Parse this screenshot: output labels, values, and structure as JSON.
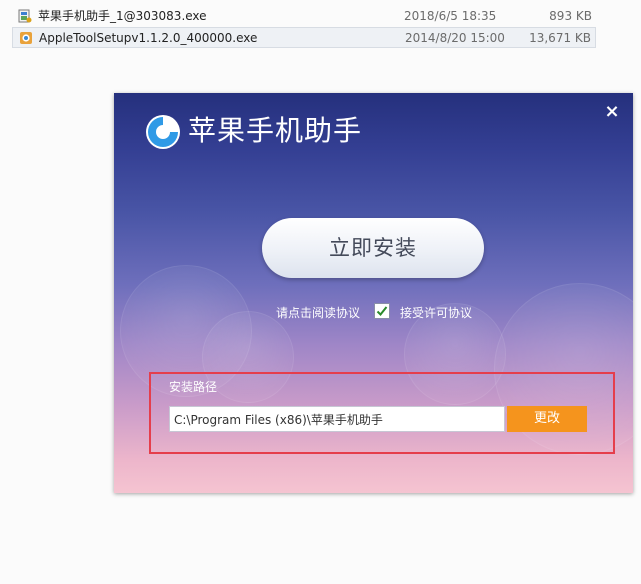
{
  "file_list": {
    "rows": [
      {
        "name": "苹果手机助手_1@303083.exe",
        "date": "2018/6/5 18:35",
        "size": "893 KB",
        "icon": "installer-app-icon"
      },
      {
        "name": "AppleToolSetupv1.1.2.0_400000.exe",
        "date": "2014/8/20 15:00",
        "size": "13,671 KB",
        "icon": "apple-tool-exe-icon"
      }
    ]
  },
  "installer": {
    "title": "苹果手机助手",
    "close_label": "×",
    "install_button": "立即安装",
    "read_agreement": "请点击阅读协议",
    "accept_checked": true,
    "accept_label": "接受许可协议",
    "path_label": "安装路径",
    "path_value": "C:\\Program Files (x86)\\苹果手机助手",
    "change_button": "更改",
    "colors": {
      "accent": "#f5941d",
      "highlight_frame": "#e53e4c",
      "logo_blue": "#2f9ae6"
    }
  }
}
